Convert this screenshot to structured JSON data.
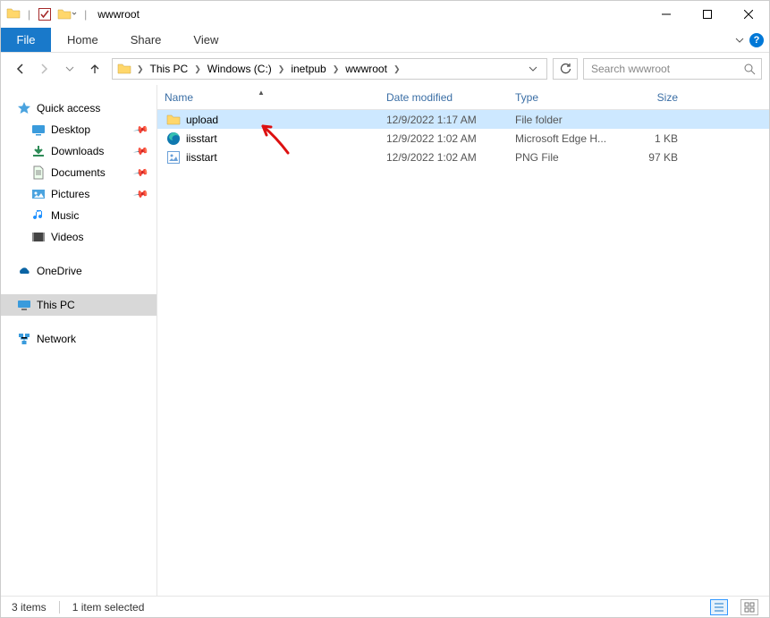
{
  "title": "wwwroot",
  "ribbon": {
    "file": "File",
    "home": "Home",
    "share": "Share",
    "view": "View"
  },
  "breadcrumbs": [
    "This PC",
    "Windows (C:)",
    "inetpub",
    "wwwroot"
  ],
  "search": {
    "placeholder": "Search wwwroot"
  },
  "columns": {
    "name": "Name",
    "date": "Date modified",
    "type": "Type",
    "size": "Size"
  },
  "sidebar": {
    "quick_access": "Quick access",
    "desktop": "Desktop",
    "downloads": "Downloads",
    "documents": "Documents",
    "pictures": "Pictures",
    "music": "Music",
    "videos": "Videos",
    "onedrive": "OneDrive",
    "this_pc": "This PC",
    "network": "Network"
  },
  "files": [
    {
      "name": "upload",
      "date": "12/9/2022 1:17 AM",
      "type": "File folder",
      "size": "",
      "icon": "folder",
      "selected": true
    },
    {
      "name": "iisstart",
      "date": "12/9/2022 1:02 AM",
      "type": "Microsoft Edge H...",
      "size": "1 KB",
      "icon": "edge",
      "selected": false
    },
    {
      "name": "iisstart",
      "date": "12/9/2022 1:02 AM",
      "type": "PNG File",
      "size": "97 KB",
      "icon": "image",
      "selected": false
    }
  ],
  "status": {
    "count": "3 items",
    "sel": "1 item selected"
  }
}
